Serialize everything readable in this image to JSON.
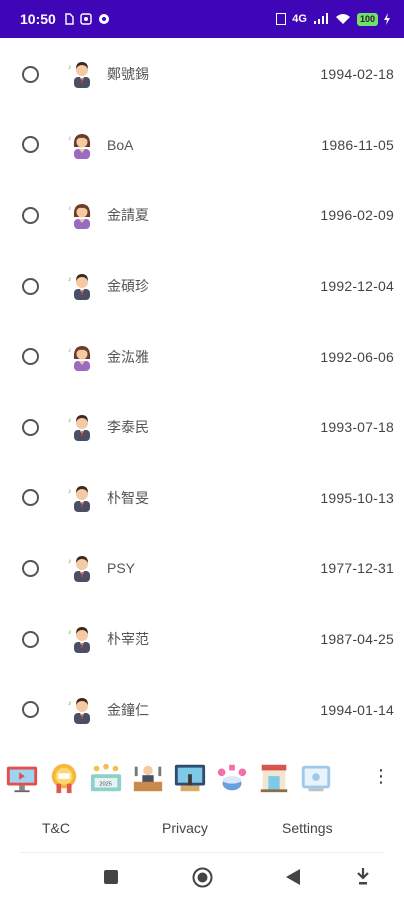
{
  "status_bar": {
    "time": "10:50",
    "network": "4G",
    "battery": "100"
  },
  "list": [
    {
      "name": "鄭號錫",
      "date": "1994-02-18",
      "gender": "male"
    },
    {
      "name": "BoA",
      "date": "1986-11-05",
      "gender": "female"
    },
    {
      "name": "金請夏",
      "date": "1996-02-09",
      "gender": "female"
    },
    {
      "name": "金碩珍",
      "date": "1992-12-04",
      "gender": "male"
    },
    {
      "name": "金汯雅",
      "date": "1992-06-06",
      "gender": "female"
    },
    {
      "name": "李泰民",
      "date": "1993-07-18",
      "gender": "male"
    },
    {
      "name": "朴智旻",
      "date": "1995-10-13",
      "gender": "male"
    },
    {
      "name": "PSY",
      "date": "1977-12-31",
      "gender": "male"
    },
    {
      "name": "朴宰范",
      "date": "1987-04-25",
      "gender": "male"
    },
    {
      "name": "金鐘仁",
      "date": "1994-01-14",
      "gender": "male"
    }
  ],
  "app_icons": [
    "monitor-icon",
    "award-medal-icon",
    "cinema-stage-icon",
    "podcast-desk-icon",
    "tv-studio-icon",
    "drum-kit-icon",
    "shop-front-icon",
    "tablet-icon"
  ],
  "links": {
    "tc": "T&C",
    "privacy": "Privacy",
    "settings": "Settings"
  },
  "colors": {
    "status_bar": "#3f06b8",
    "battery": "#6fe06a"
  }
}
